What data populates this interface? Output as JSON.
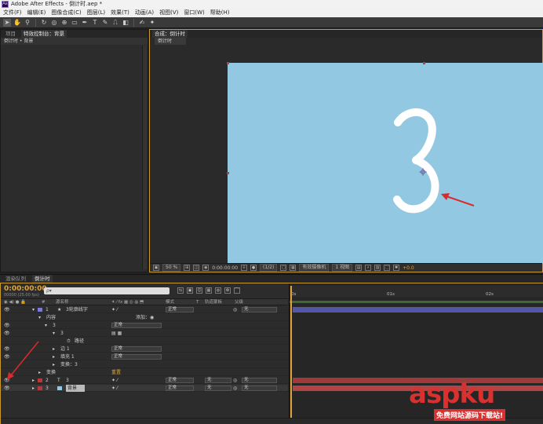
{
  "window": {
    "title": "Adobe After Effects - 倒计时.aep *",
    "app_icon": "Ae"
  },
  "menu": [
    "文件(F)",
    "编辑(E)",
    "图像合成(C)",
    "图层(L)",
    "效果(T)",
    "动画(A)",
    "视图(V)",
    "窗口(W)",
    "帮助(H)"
  ],
  "tools": [
    "selection-arrow-icon",
    "hand-icon",
    "zoom-icon",
    "rotate-icon",
    "camera-orbit-icon",
    "pan-behind-icon",
    "rectangle-mask-icon",
    "pen-icon",
    "type-icon",
    "brush-icon",
    "clone-stamp-icon",
    "eraser-icon",
    "roto-brush-icon",
    "puppet-pin-icon"
  ],
  "left_panel": {
    "tabs": [
      "项目",
      "特效控制台：背景"
    ],
    "breadcrumb": "倒计时 • 背景"
  },
  "comp_panel": {
    "tab": "合成：倒计时",
    "subtab": "倒计时",
    "big_digit": "3",
    "footer": {
      "zoom": "50 %",
      "timecode": "0:00:00:00",
      "resolution": "(1/2)",
      "camera": "有效摄像机",
      "views": "1 视图",
      "exposure": "+0.0"
    }
  },
  "timeline": {
    "tabs": [
      "渲染队列",
      "倒计时"
    ],
    "timecode": "0:00:00:00",
    "fps": "00000 (25.00 fps)",
    "search_placeholder": "ρ▾",
    "header": {
      "name": "源名称",
      "mode": "模式",
      "t": "T",
      "trkmat": "轨道蒙板",
      "parent": "父级"
    },
    "rows": [
      {
        "num": "1",
        "star": "★",
        "name": "3轮廓线字",
        "mode": "正常",
        "parent": "无",
        "color": "#7a7adb"
      },
      {
        "name": "内容",
        "extra": "添加：◉"
      },
      {
        "name": "3",
        "mode": "正常"
      },
      {
        "name": "3"
      },
      {
        "name": "路径"
      },
      {
        "name": "边 1",
        "mode": "正常"
      },
      {
        "name": "填充 1",
        "mode": "正常"
      },
      {
        "name": "变换：3"
      },
      {
        "name": "变换",
        "extra": "重置"
      },
      {
        "num": "2",
        "name": "3",
        "mode": "正常",
        "trkmat": "无",
        "parent": "无",
        "color": "#b23b3b"
      },
      {
        "num": "3",
        "name": "背景",
        "mode": "正常",
        "trkmat": "无",
        "parent": "无",
        "color": "#b23b3b"
      }
    ],
    "ruler": [
      "0s",
      "01s",
      "02s"
    ]
  },
  "watermark": {
    "main": "aspku",
    "sub": "免费网站源码下载站!"
  }
}
